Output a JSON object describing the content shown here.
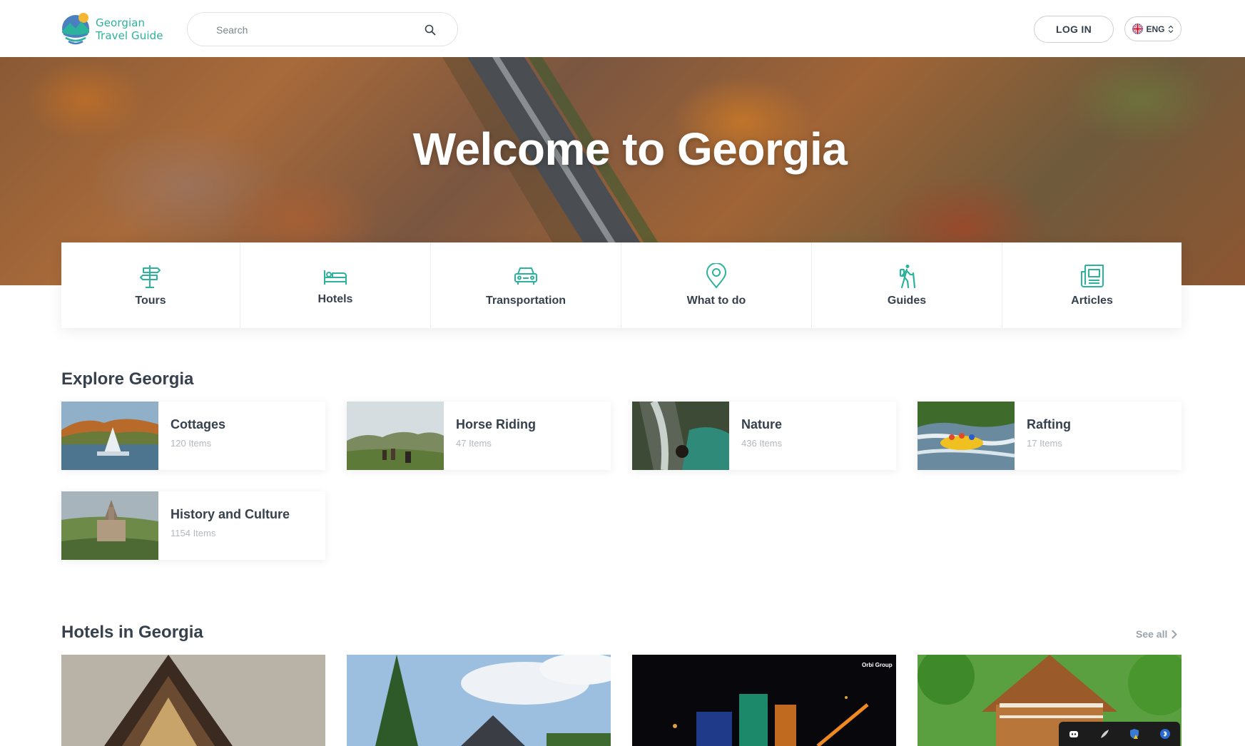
{
  "header": {
    "logo": {
      "line1": "Georgian",
      "line2": "Travel Guide"
    },
    "search": {
      "placeholder": "Search"
    },
    "login_label": "LOG IN",
    "language": "ENG"
  },
  "hero": {
    "title": "Welcome to Georgia"
  },
  "categories": [
    {
      "label": "Tours",
      "icon": "signpost-icon"
    },
    {
      "label": "Hotels",
      "icon": "bed-icon"
    },
    {
      "label": "Transportation",
      "icon": "car-icon"
    },
    {
      "label": "What to do",
      "icon": "map-pin-icon"
    },
    {
      "label": "Guides",
      "icon": "hiker-icon"
    },
    {
      "label": "Articles",
      "icon": "newspaper-icon"
    }
  ],
  "explore": {
    "title": "Explore Georgia",
    "items": [
      {
        "title": "Cottages",
        "count": "120 Items"
      },
      {
        "title": "Horse Riding",
        "count": "47 Items"
      },
      {
        "title": "Nature",
        "count": "436 Items"
      },
      {
        "title": "Rafting",
        "count": "17 Items"
      },
      {
        "title": "History and Culture",
        "count": "1154 Items"
      }
    ]
  },
  "hotels": {
    "title": "Hotels in Georgia",
    "see_all": "See all",
    "watermark": "Orbi Group"
  },
  "colors": {
    "accent": "#2bb39b",
    "text": "#36414d",
    "muted": "#b2b9c0"
  }
}
